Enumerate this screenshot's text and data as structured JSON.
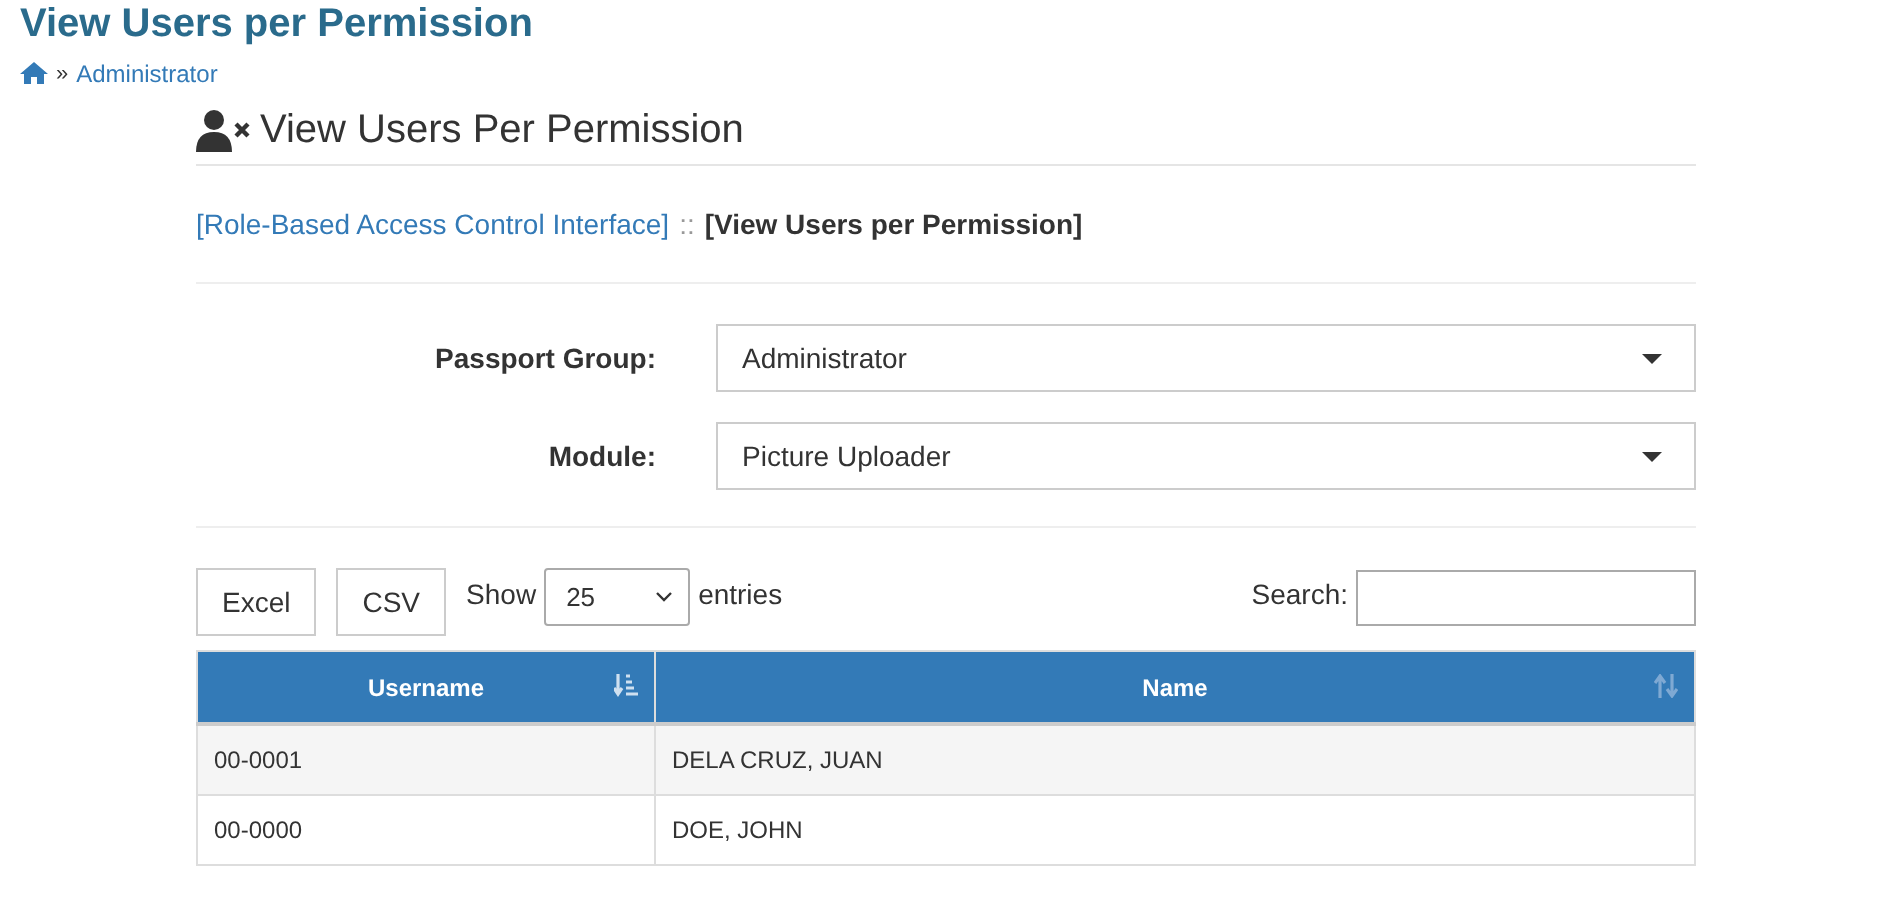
{
  "page_title": "View Users per Permission",
  "breadcrumb": {
    "separator": "»",
    "items": [
      "Administrator"
    ]
  },
  "panel": {
    "title": "View Users Per Permission",
    "path": {
      "link": "[Role-Based Access Control Interface]",
      "separator": "::",
      "current": "[View Users per Permission]"
    },
    "filters": [
      {
        "label": "Passport Group:",
        "value": "Administrator"
      },
      {
        "label": "Module:",
        "value": "Picture Uploader"
      }
    ],
    "export_buttons": [
      "Excel",
      "CSV"
    ],
    "length": {
      "before": "Show",
      "value": "25",
      "after": "entries"
    },
    "search": {
      "label": "Search:"
    },
    "table": {
      "columns": [
        {
          "label": "Username",
          "sorted": true
        },
        {
          "label": "Name",
          "sorted": false
        }
      ],
      "rows": [
        {
          "cells": [
            "00-0001",
            "DELA CRUZ, JUAN"
          ]
        },
        {
          "cells": [
            "00-0000",
            "DOE, JOHN"
          ]
        }
      ]
    }
  }
}
